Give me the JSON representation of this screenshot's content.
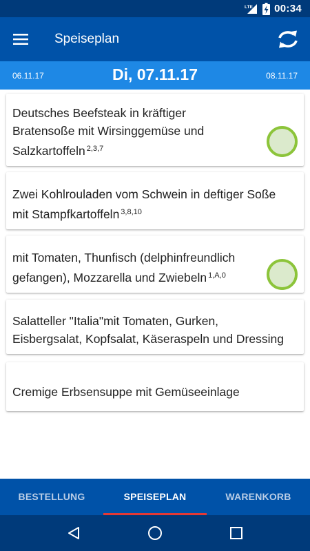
{
  "status_bar": {
    "network": "LTE",
    "time": "00:34",
    "icons": [
      "lte-signal-icon",
      "battery-charging-icon"
    ]
  },
  "app_bar": {
    "title": "Speiseplan",
    "icons": [
      "hamburger-menu-icon",
      "refresh-icon"
    ]
  },
  "date_bar": {
    "previous": "06.11.17",
    "current": "Di, 07.11.17",
    "next": "08.11.17"
  },
  "menu_items": [
    {
      "text": "Deutsches Beefsteak in kräftiger Bratensoße mit Wirsinggemüse und Salzkartoffeln",
      "allergens": "2,3,7",
      "selected": true
    },
    {
      "text": "Zwei Kohlrouladen vom Schwein in deftiger Soße mit Stampfkartoffeln",
      "allergens": "3,8,10",
      "selected": false
    },
    {
      "text": "mit Tomaten, Thunfisch (delphinfreundlich gefangen), Mozzarella und Zwiebeln",
      "allergens": "1,A,0",
      "selected": true
    },
    {
      "text": "Salatteller \"Italia\"mit Tomaten, Gurken, Eisbergsalat, Kopfsalat, Käseraspeln und Dressing",
      "allergens": "",
      "selected": false
    },
    {
      "text": "Cremige Erbsensuppe mit Gemüseeinlage",
      "allergens": "",
      "selected": false
    }
  ],
  "bottom_nav": {
    "tabs": [
      {
        "label": "BESTELLUNG",
        "active": false
      },
      {
        "label": "SPEISEPLAN",
        "active": true
      },
      {
        "label": "WARENKORB",
        "active": false
      }
    ]
  },
  "system_nav": {
    "icons": [
      "back-icon",
      "home-icon",
      "recents-icon"
    ]
  },
  "colors": {
    "status_bar": "#003a7a",
    "app_bar": "#0052a8",
    "date_bar": "#1e88e5",
    "check_border": "#8cc43a",
    "check_fill": "#dbeacc",
    "tab_indicator": "#e53935"
  }
}
